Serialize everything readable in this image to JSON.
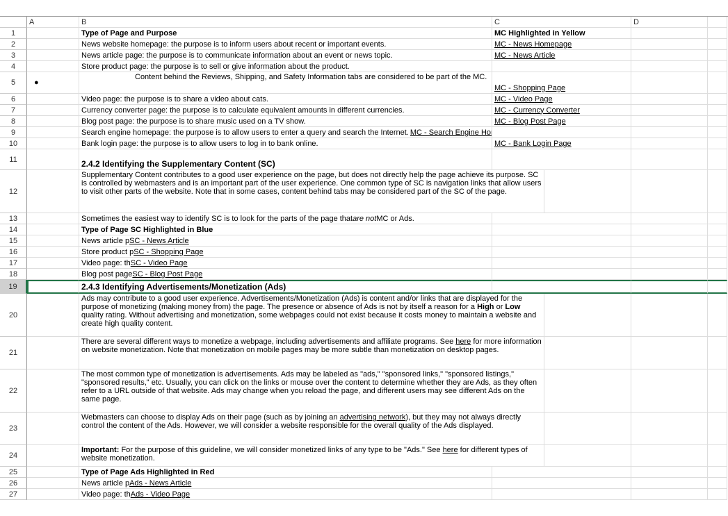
{
  "columns": {
    "A": "A",
    "B": "B",
    "C": "C",
    "D": "D"
  },
  "rows": {
    "r1": {
      "B": "Type of Page and Purpose",
      "C": "MC Highlighted in Yellow"
    },
    "r2": {
      "B": "News website homepage: the purpose is to inform users about recent or important events.",
      "C": "MC - News Homepage"
    },
    "r3": {
      "B": "News article page: the purpose is to communicate information about an event or news topic.",
      "C": "MC - News Article"
    },
    "r4": {
      "B": "Store product page: the purpose is to sell or give information about the product."
    },
    "r5": {
      "B": "Content behind the Reviews, Shipping, and Safety Information tabs are considered to be part of the MC.",
      "C": "MC - Shopping Page"
    },
    "r6": {
      "B": "Video page: the purpose is to share a video about cats.",
      "C": "MC - Video Page"
    },
    "r7": {
      "B": "Currency converter page: the purpose is to calculate equivalent amounts in different currencies.",
      "C": "MC - Currency Converter"
    },
    "r8": {
      "B": "Blog post page: the purpose is to share music used on a TV show.",
      "C": "MC - Blog Post Page"
    },
    "r9": {
      "B_pre": "Search engine homepage: the purpose is to allow users to enter a query and search the Internet. ",
      "B_link": "MC - Search Engine Homepage"
    },
    "r10": {
      "B": "Bank login page: the purpose is to allow users to log in to bank online.",
      "C": "MC - Bank Login Page"
    },
    "r11": {
      "B": "2.4.2 Identifying the Supplementary Content (SC)"
    },
    "r12": {
      "B": "Supplementary Content contributes to a good user experience on the page, but does not directly help the page achieve its purpose. SC is controlled by webmasters and is an important part of the user experience. One common type of SC is navigation links that allow users to visit other parts of the website. Note that in some cases, content behind tabs may be considered part of the SC of the page."
    },
    "r13": {
      "B_pre": "Sometimes the easiest way to identify SC is to look for the parts of the page that ",
      "B_em": "are not",
      "B_post": " MC or Ads."
    },
    "r14": {
      "B": "Type of Page SC Highlighted in Blue"
    },
    "r15": {
      "B_pre": "News article p",
      "B_link": " SC - News Article"
    },
    "r16": {
      "B_pre": "Store product p",
      "B_link": " SC - Shopping Page"
    },
    "r17": {
      "B_pre": "Video page: th",
      "B_link": " SC - Video Page"
    },
    "r18": {
      "B_pre": "Blog post page",
      "B_link": " SC - Blog Post Page"
    },
    "r19": {
      "B": "2.4.3 Identifying Advertisements/Monetization (Ads)"
    },
    "r20": {
      "B_pre": "Ads may contribute to a good user experience. Advertisements/Monetization (Ads) is content and/or links that are displayed for the purpose of monetizing (making money from) the page. The presence or absence of Ads is not by itself a reason for a ",
      "B_b1": "High",
      "B_mid1": " or ",
      "B_b2": "Low",
      "B_post": " quality rating. Without advertising and monetization, some webpages could not exist because it costs money to maintain a website and create high quality content."
    },
    "r21": {
      "B_pre": "There are several different ways to monetize a webpage, including advertisements and affiliate programs. See ",
      "B_link": "here",
      "B_post": " for more information on website monetization. Note that monetization on mobile pages may be more subtle than monetization on desktop pages."
    },
    "r22": {
      "B": "The most common type of monetization is advertisements. Ads may be labeled as \"ads,\" \"sponsored links,\" \"sponsored listings,\" \"sponsored results,\" etc. Usually, you can click on the links or mouse over the content to determine whether they are Ads, as they often refer to a URL outside of that website. Ads may change when you reload the page, and different users may see different Ads on the same page."
    },
    "r23": {
      "B_pre": "Webmasters can choose to display Ads on their page (such as by joining an ",
      "B_link": "advertising network",
      "B_post": "), but they may not always directly control the content of the Ads. However, we will consider a website responsible for the overall quality of the Ads displayed."
    },
    "r24": {
      "B_b": "Important:",
      "B_pre": " For the purpose of this guideline, we will consider monetized links of any type to be \"Ads.\" See ",
      "B_link": "here",
      "B_post": " for different types of website monetization."
    },
    "r25": {
      "B": "Type of Page Ads Highlighted in Red"
    },
    "r26": {
      "B_pre": "News article p",
      "B_link": " Ads - News Article"
    },
    "r27": {
      "B_pre": "Video page: th",
      "B_link": " Ads - Video Page"
    }
  },
  "rowNumbers": [
    "1",
    "2",
    "3",
    "4",
    "5",
    "6",
    "7",
    "8",
    "9",
    "10",
    "11",
    "12",
    "13",
    "14",
    "15",
    "16",
    "17",
    "18",
    "19",
    "20",
    "21",
    "22",
    "23",
    "24",
    "25",
    "26",
    "27"
  ]
}
